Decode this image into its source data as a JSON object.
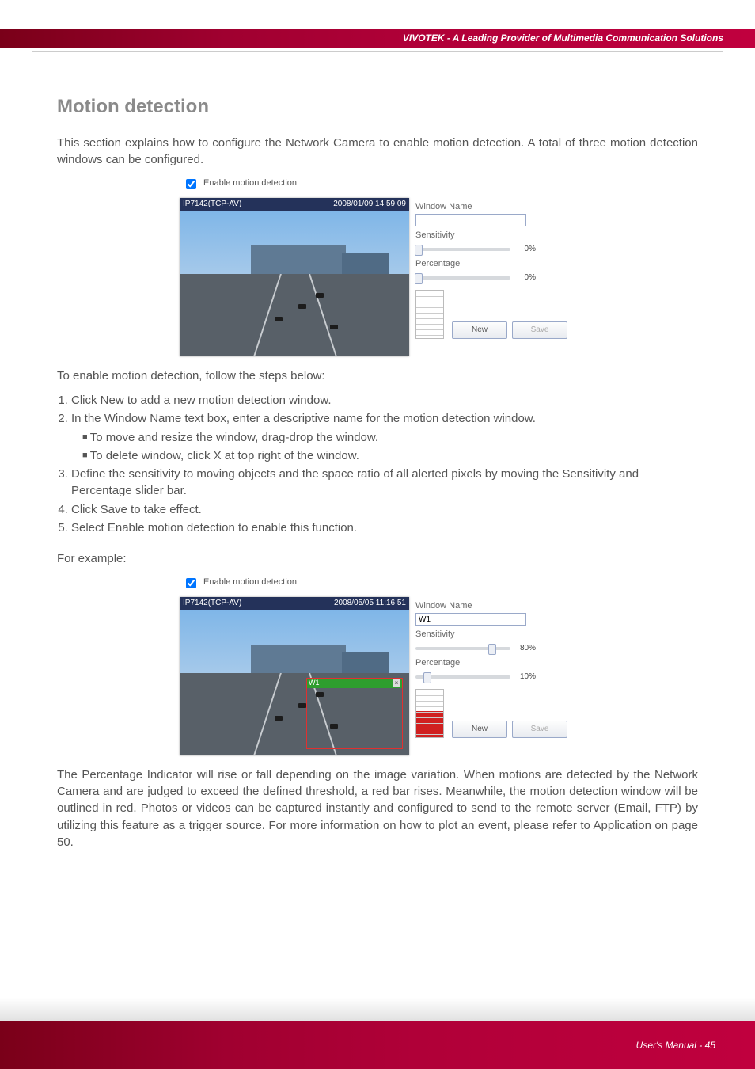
{
  "header": {
    "tagline": "VIVOTEK - A Leading Provider of Multimedia Communication Solutions"
  },
  "section": {
    "title": "Motion detection"
  },
  "intro": "This section explains how to configure the Network Camera to enable motion detection. A total of three motion detection windows can be configured.",
  "ui1": {
    "enable_label": "Enable motion detection",
    "camera": "IP7142(TCP-AV)",
    "timestamp": "2008/01/09 14:59:09",
    "wn_label": "Window Name",
    "wn_value": "",
    "sens_label": "Sensitivity",
    "sens_value": "0%",
    "perc_label": "Percentage",
    "perc_value": "0%",
    "new_btn": "New",
    "save_btn": "Save",
    "meter_fill": "0%"
  },
  "steps": {
    "lead": "To enable motion detection, follow the steps below:",
    "s1": "Click New to add a new motion detection window.",
    "s2": "In the Window Name text box, enter a descriptive name for the motion detection window.",
    "s2a": "To move and resize the window, drag-drop the window.",
    "s2b": "To delete window, click X at top right of the window.",
    "s3": "Define the sensitivity to moving objects and the space ratio of all alerted pixels by moving the Sensitivity and Percentage slider bar.",
    "s4": "Click Save to take effect.",
    "s5": "Select Enable motion detection to enable this function."
  },
  "example_label": "For example:",
  "ui2": {
    "enable_label": "Enable motion detection",
    "camera": "IP7142(TCP-AV)",
    "timestamp": "2008/05/05 11:16:51",
    "wn_label": "Window Name",
    "wn_value": "W1",
    "sens_label": "Sensitivity",
    "sens_value": "80%",
    "perc_label": "Percentage",
    "perc_value": "10%",
    "new_btn": "New",
    "save_btn": "Save",
    "det_win_label": "W1",
    "meter_fill": "55%"
  },
  "explain": "The Percentage Indicator will rise or fall depending on the image variation. When motions are detected by the Network Camera and are judged to exceed the defined threshold, a red bar rises. Meanwhile, the motion detection window will be outlined in red. Photos or videos can be captured instantly and configured to send to the remote server (Email, FTP) by utilizing this feature as a trigger source. For more information on how to plot an event, please refer to Application on page 50.",
  "footer": {
    "text": "User's Manual - 45"
  }
}
